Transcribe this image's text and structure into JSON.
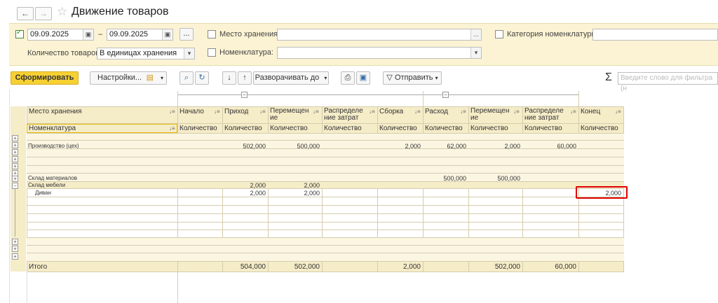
{
  "window": {
    "title": "Движение товаров"
  },
  "filters": {
    "period_from": "09.09.2025",
    "period_to": "09.09.2025",
    "dash": "–",
    "ellipsis": "...",
    "storage_label": "Место хранения:",
    "category_label": "Категория номенклатуры:",
    "qty_label": "Количество товаров:",
    "qty_value": "В единицах хранения",
    "nomenclature_label": "Номенклатура:"
  },
  "toolbar": {
    "generate": "Сформировать",
    "settings": "Настройки...",
    "expand": "Разворачивать до",
    "send": "Отправить",
    "search_placeholder": "Введите слово для фильтра (н"
  },
  "table": {
    "headers": {
      "storage": "Место хранения",
      "nomenclature": "Номенклатура",
      "start": "Начало",
      "income": "Приход",
      "move_in_1": "Перемещен",
      "move_in_2": "ие",
      "alloc_in_1": "Распределе",
      "alloc_in_2": "ние затрат",
      "assembly": "Сборка",
      "expense": "Расход",
      "move_out_1": "Перемещен",
      "move_out_2": "ие",
      "alloc_out_1": "Распределе",
      "alloc_out_2": "ние затрат",
      "end": "Конец",
      "quantity": "Количество"
    },
    "rows": [
      {
        "label": "",
        "values": [
          "",
          "",
          "",
          "",
          "",
          "",
          "",
          "",
          ""
        ]
      },
      {
        "label": "Производство (цех)",
        "values": [
          "",
          "502,000",
          "500,000",
          "",
          "2,000",
          "62,000",
          "2,000",
          "60,000",
          ""
        ]
      },
      {
        "label": "Склад материалов",
        "values": [
          "",
          "",
          "",
          "",
          "",
          "500,000",
          "500,000",
          "",
          ""
        ]
      },
      {
        "label": "Склад мебели",
        "values": [
          "",
          "2,000",
          "2,000",
          "",
          "",
          "",
          "",
          "",
          ""
        ]
      },
      {
        "label": "Диван",
        "values": [
          "",
          "2,000",
          "2,000",
          "",
          "",
          "",
          "",
          "",
          "2,000"
        ]
      }
    ],
    "total": {
      "label": "Итого",
      "values": [
        "",
        "504,000",
        "502,000",
        "",
        "2,000",
        "",
        "502,000",
        "60,000",
        ""
      ]
    }
  },
  "colors": {
    "accent": "#f7d033",
    "panel": "#fbf3d3",
    "header": "#f5ecc8",
    "highlight": "#e00000"
  }
}
